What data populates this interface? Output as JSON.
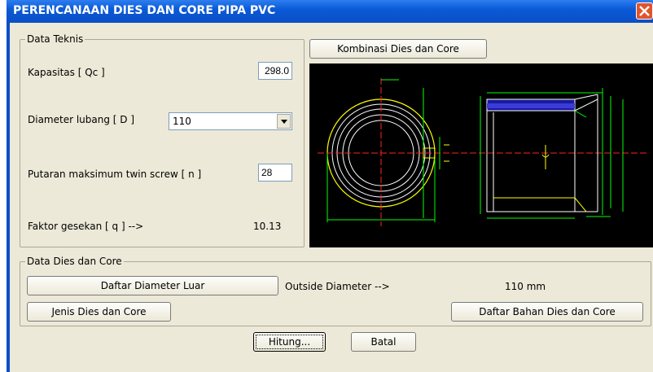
{
  "window": {
    "title": "PERENCANAAN DIES DAN CORE PIPA PVC"
  },
  "data_teknis": {
    "legend": "Data Teknis",
    "kapasitas_label": "Kapasitas  [ Qc ]",
    "kapasitas_value": "298.0",
    "diameter_label": "Diameter lubang  [ D ]",
    "diameter_value": "110",
    "putaran_label": "Putaran maksimum twin screw  [ n ]",
    "putaran_value": "28",
    "faktor_label": "Faktor gesekan  [ q ] -->",
    "faktor_value": "10.13"
  },
  "kombinasi_button": "Kombinasi Dies dan Core",
  "data_dies": {
    "legend": "Data Dies dan Core",
    "daftar_diameter_button": "Daftar Diameter Luar",
    "outside_label": "Outside Diameter  -->",
    "outside_value": "110 mm",
    "jenis_button": "Jenis Dies dan Core",
    "daftar_bahan_button": "Daftar Bahan Dies dan Core"
  },
  "actions": {
    "hitung": "Hitung...",
    "batal": "Batal"
  },
  "colors": {
    "titlebar": "#0a4fc4",
    "window_bg": "#ece9d8",
    "drawing_bg": "#000000"
  }
}
